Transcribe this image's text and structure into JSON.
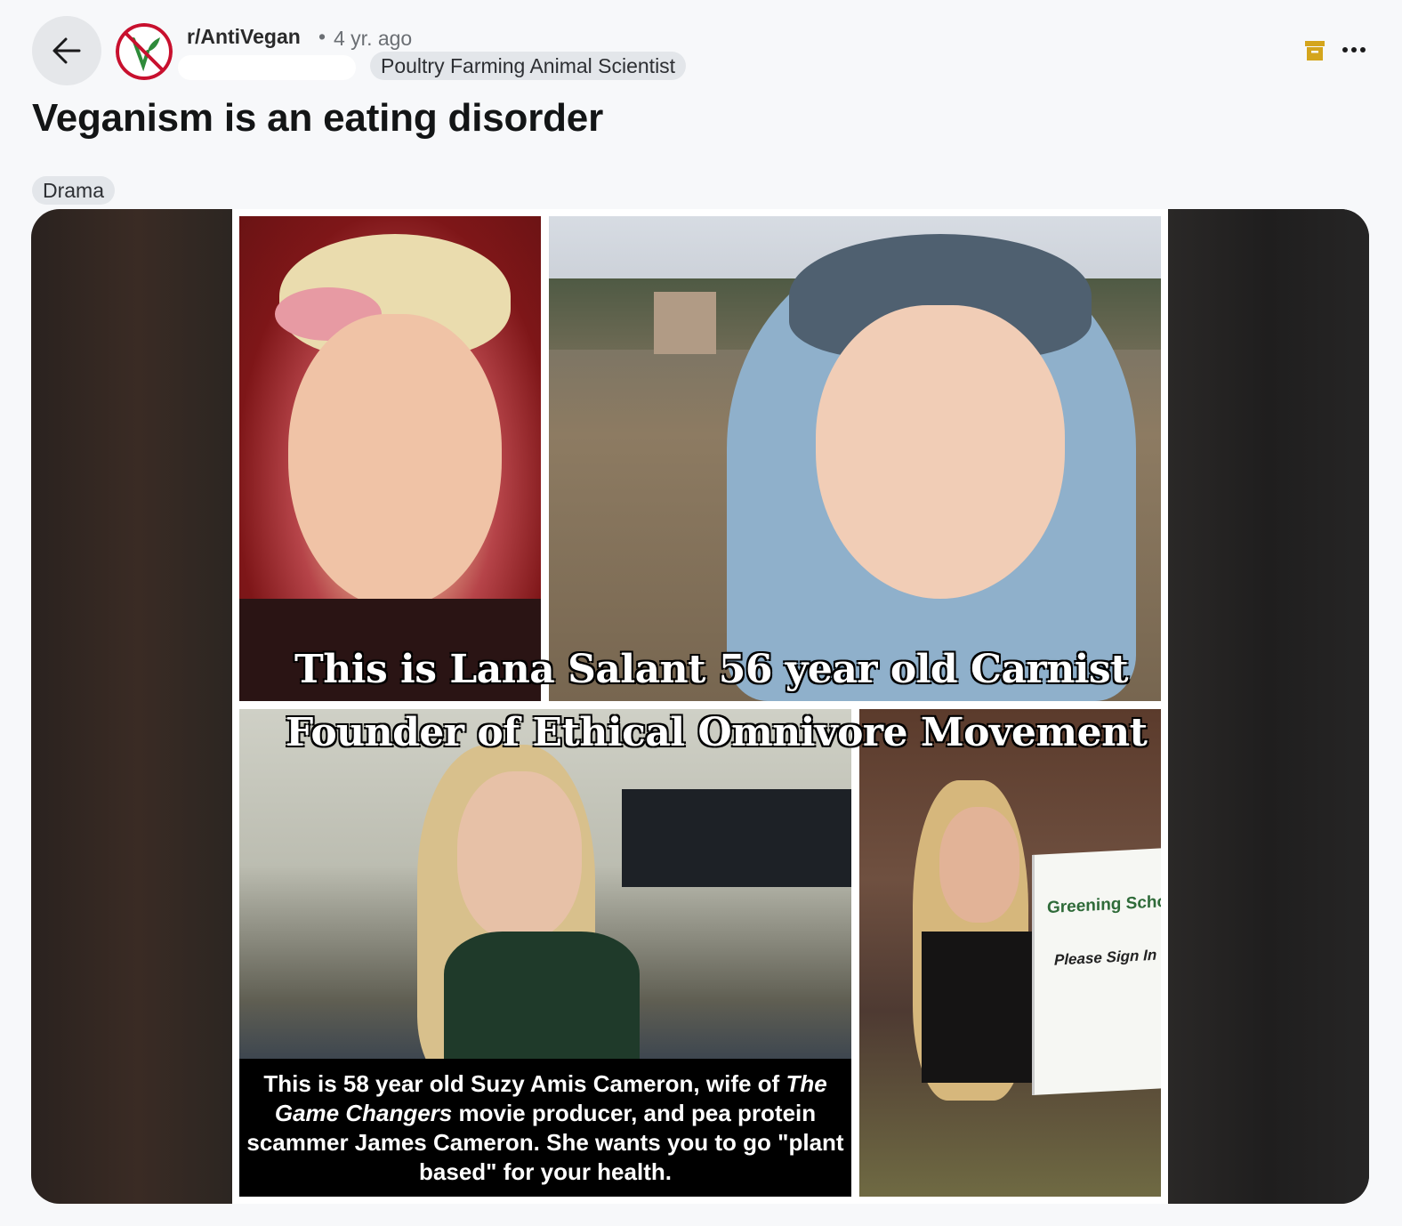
{
  "header": {
    "subreddit": "r/AntiVegan",
    "separator": "•",
    "timestamp": "4 yr. ago",
    "user_flair": "Poultry Farming Animal Scientist"
  },
  "icons": {
    "back": "back-arrow-icon",
    "avatar": "no-vegan-icon",
    "archive": "archive-icon",
    "more": "more-options-icon"
  },
  "colors": {
    "background": "#f7f8fa",
    "flair_bg": "#e3e6ea",
    "archive_icon": "#d4a51c",
    "avatar_ring": "#c8102e",
    "avatar_leaf": "#2e8b3a"
  },
  "post": {
    "title": "Veganism is an eating disorder",
    "flair": "Drama"
  },
  "image": {
    "overlay_line1": "This is Lana Salant 56 year old Carnist",
    "overlay_line2": "Founder of Ethical Omnivore Movement",
    "caption_part1": "This is 58 year old Suzy Amis Cameron, wife of ",
    "caption_italic": "The Game Changers",
    "caption_part2": " movie producer, and pea protein scammer James Cameron. She wants you to go \"plant based\" for your health.",
    "sign_title": "Greening Schoo",
    "sign_subtitle": "Please Sign In"
  }
}
